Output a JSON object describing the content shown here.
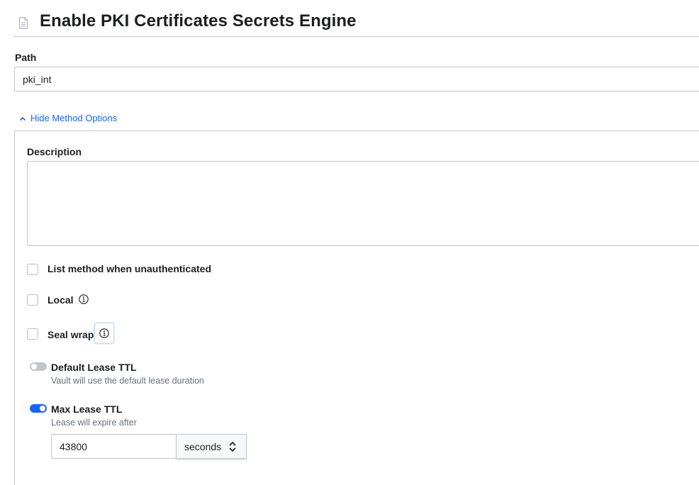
{
  "header": {
    "title": "Enable PKI Certificates Secrets Engine",
    "icon": "document-icon"
  },
  "path": {
    "label": "Path",
    "value": "pki_int"
  },
  "method_options": {
    "toggle_label": "Hide Method Options",
    "description": {
      "label": "Description",
      "value": ""
    },
    "list_unauthenticated": {
      "label": "List method when unauthenticated",
      "checked": false
    },
    "local": {
      "label": "Local",
      "checked": false,
      "icon": "info-icon"
    },
    "seal_wrap": {
      "label": "Seal wrap",
      "checked": false,
      "icon": "info-icon"
    },
    "default_lease_ttl": {
      "label": "Default Lease TTL",
      "help": "Vault will use the default lease duration",
      "enabled": false
    },
    "max_lease_ttl": {
      "label": "Max Lease TTL",
      "help": "Lease will expire after",
      "enabled": true,
      "value": "43800",
      "unit": "seconds"
    }
  },
  "colors": {
    "accent": "#1563ff",
    "border": "#c2c5cb",
    "text": "#1d1e20",
    "muted": "#6a7078"
  }
}
